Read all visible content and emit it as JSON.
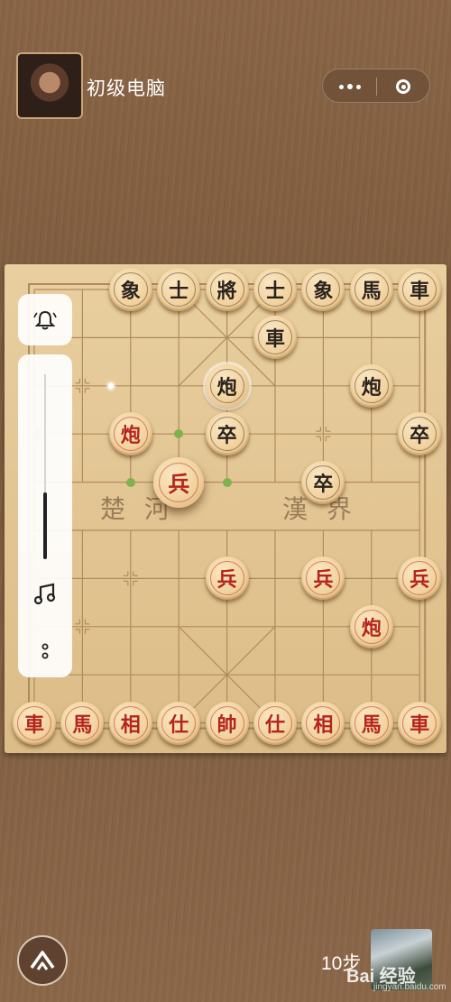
{
  "header": {
    "opponent_name": "初级电脑",
    "menu_icon": "more-dots-icon",
    "close_icon": "target-close-icon"
  },
  "board": {
    "river_left": "楚 河",
    "river_right": "漢 界",
    "colors": {
      "red": "#b5251b",
      "black": "#2a221c",
      "hint": "#7fb24a"
    },
    "pieces": [
      {
        "label": "象",
        "side": "black",
        "col": 2,
        "row": 0
      },
      {
        "label": "士",
        "side": "black",
        "col": 3,
        "row": 0
      },
      {
        "label": "將",
        "side": "black",
        "col": 4,
        "row": 0
      },
      {
        "label": "士",
        "side": "black",
        "col": 5,
        "row": 0
      },
      {
        "label": "象",
        "side": "black",
        "col": 6,
        "row": 0
      },
      {
        "label": "馬",
        "side": "black",
        "col": 7,
        "row": 0
      },
      {
        "label": "車",
        "side": "black",
        "col": 8,
        "row": 0
      },
      {
        "label": "車",
        "side": "black",
        "col": 5,
        "row": 1
      },
      {
        "label": "炮",
        "side": "black",
        "col": 4,
        "row": 2,
        "glow": true
      },
      {
        "label": "炮",
        "side": "black",
        "col": 7,
        "row": 2
      },
      {
        "label": "炮",
        "side": "red",
        "col": 2,
        "row": 3
      },
      {
        "label": "卒",
        "side": "black",
        "col": 4,
        "row": 3
      },
      {
        "label": "卒",
        "side": "black",
        "col": 8,
        "row": 3
      },
      {
        "label": "兵",
        "side": "red",
        "col": 3,
        "row": 4,
        "selected": true
      },
      {
        "label": "卒",
        "side": "black",
        "col": 6,
        "row": 4
      },
      {
        "label": "兵",
        "side": "red",
        "col": 4,
        "row": 6
      },
      {
        "label": "兵",
        "side": "red",
        "col": 6,
        "row": 6
      },
      {
        "label": "兵",
        "side": "red",
        "col": 8,
        "row": 6
      },
      {
        "label": "炮",
        "side": "red",
        "col": 7,
        "row": 7
      },
      {
        "label": "車",
        "side": "red",
        "col": 0,
        "row": 9
      },
      {
        "label": "馬",
        "side": "red",
        "col": 1,
        "row": 9
      },
      {
        "label": "相",
        "side": "red",
        "col": 2,
        "row": 9
      },
      {
        "label": "仕",
        "side": "red",
        "col": 3,
        "row": 9
      },
      {
        "label": "帥",
        "side": "red",
        "col": 4,
        "row": 9
      },
      {
        "label": "仕",
        "side": "red",
        "col": 5,
        "row": 9
      },
      {
        "label": "相",
        "side": "red",
        "col": 6,
        "row": 9
      },
      {
        "label": "馬",
        "side": "red",
        "col": 7,
        "row": 9
      },
      {
        "label": "車",
        "side": "red",
        "col": 8,
        "row": 9
      }
    ],
    "move_hints": [
      {
        "col": 3,
        "row": 3
      },
      {
        "col": 2,
        "row": 4
      },
      {
        "col": 4,
        "row": 4
      }
    ]
  },
  "side_panel": {
    "bell_icon": "bell-icon",
    "volume_level": 0.36,
    "music_icon": "music-note-icon",
    "more_icon": "more-vertical-icon"
  },
  "footer": {
    "steps": "10步",
    "home_icon": "home-up-icon",
    "watermark": "Bai 经验",
    "watermark_sub": "jingyan.baidu.com"
  }
}
